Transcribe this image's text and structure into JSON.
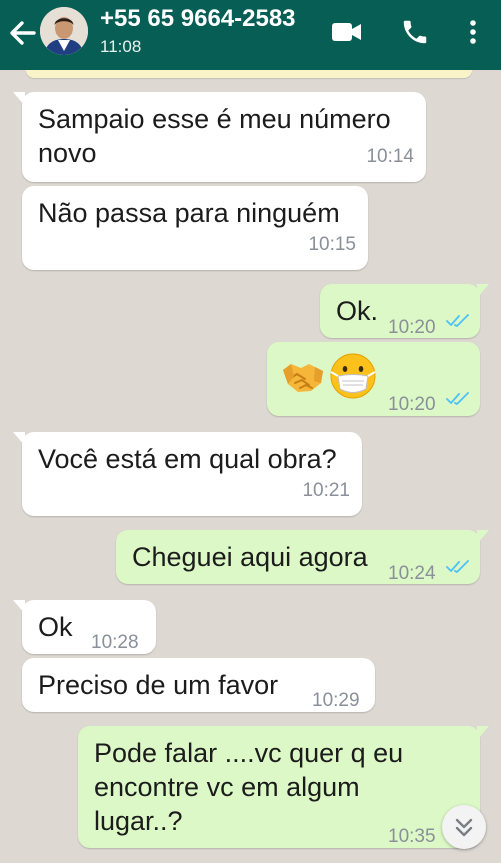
{
  "header": {
    "contact_name": "+55 65 9664-2583",
    "status_time": "11:08"
  },
  "messages": [
    {
      "direction": "incoming",
      "text": "Sampaio esse é meu número\nnovo",
      "time": "10:14"
    },
    {
      "direction": "incoming",
      "text": "Não passa para ninguém",
      "time": "10:15"
    },
    {
      "direction": "outgoing",
      "text": "Ok.",
      "time": "10:20",
      "status": "read"
    },
    {
      "direction": "outgoing",
      "emoji": [
        "handshake",
        "face-with-medical-mask"
      ],
      "time": "10:20",
      "status": "read"
    },
    {
      "direction": "incoming",
      "text": "Você está em qual obra?",
      "time": "10:21"
    },
    {
      "direction": "outgoing",
      "text": "Cheguei aqui agora",
      "time": "10:24",
      "status": "read"
    },
    {
      "direction": "incoming",
      "text": "Ok",
      "time": "10:28"
    },
    {
      "direction": "incoming",
      "text": "Preciso de um favor",
      "time": "10:29"
    },
    {
      "direction": "outgoing",
      "text": "Pode falar ....vc quer q eu\nencontre vc em algum\nlugar..?",
      "time": "10:35"
    }
  ],
  "icons": {
    "back": "arrow-left-icon",
    "video": "video-call-icon",
    "phone": "phone-icon",
    "menu": "more-vertical-icon",
    "scroll": "chevron-double-down-icon"
  },
  "colors": {
    "header": "#075e54",
    "outgoing_bubble": "#dcf8c6",
    "incoming_bubble": "#ffffff",
    "chat_background": "#ddd8d2",
    "read_tick": "#4fc3f7"
  }
}
